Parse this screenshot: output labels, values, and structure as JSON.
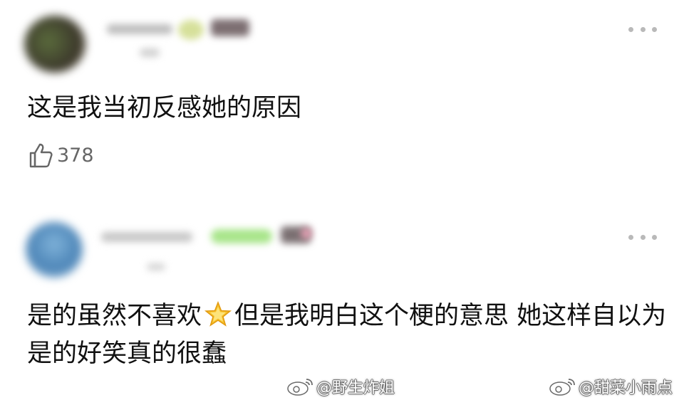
{
  "comments": [
    {
      "text": "这是我当初反感她的原因",
      "likes": "378"
    },
    {
      "text_before": "是的虽然不喜欢",
      "text_after": "但是我明白这个梗的意思 她这样自以为是的好笑真的很蠢"
    }
  ],
  "watermarks": {
    "left": "@野生炸姐",
    "right": "@甜菜小雨点"
  },
  "icons": {
    "like": "thumbs-up-icon",
    "more": "more-dots-icon",
    "emoji": "star-emoji-icon",
    "watermark": "weibo-logo-icon"
  }
}
